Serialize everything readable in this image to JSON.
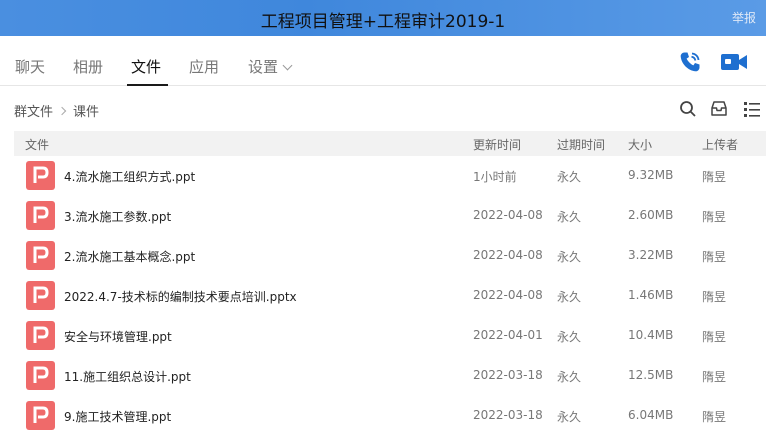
{
  "window": {
    "title": "工程项目管理+工程审计2019-1",
    "report_label": "举报"
  },
  "tabs": [
    {
      "label": "聊天",
      "active": false
    },
    {
      "label": "相册",
      "active": false
    },
    {
      "label": "文件",
      "active": true
    },
    {
      "label": "应用",
      "active": false
    },
    {
      "label": "设置",
      "active": false
    }
  ],
  "header_actions": {
    "call_icon": "phone-icon",
    "video_icon": "video-camera-icon"
  },
  "breadcrumb": {
    "root": "群文件",
    "current": "课件"
  },
  "toolbar_icons": [
    "search-icon",
    "download-box-icon",
    "list-view-icon"
  ],
  "table": {
    "columns": {
      "file": "文件",
      "updated": "更新时间",
      "expires": "过期时间",
      "size": "大小",
      "uploader": "上传者"
    },
    "rows": [
      {
        "name": "4.流水施工组织方式.ppt",
        "updated": "1小时前",
        "expires": "永久",
        "size": "9.32MB",
        "uploader": "隋昱"
      },
      {
        "name": "3.流水施工参数.ppt",
        "updated": "2022-04-08",
        "expires": "永久",
        "size": "2.60MB",
        "uploader": "隋昱"
      },
      {
        "name": "2.流水施工基本概念.ppt",
        "updated": "2022-04-08",
        "expires": "永久",
        "size": "3.22MB",
        "uploader": "隋昱"
      },
      {
        "name": "2022.4.7-技术标的编制技术要点培训.pptx",
        "updated": "2022-04-08",
        "expires": "永久",
        "size": "1.46MB",
        "uploader": "隋昱"
      },
      {
        "name": "安全与环境管理.ppt",
        "updated": "2022-04-01",
        "expires": "永久",
        "size": "10.4MB",
        "uploader": "隋昱"
      },
      {
        "name": "11.施工组织总设计.ppt",
        "updated": "2022-03-18",
        "expires": "永久",
        "size": "12.5MB",
        "uploader": "隋昱"
      },
      {
        "name": "9.施工技术管理.ppt",
        "updated": "2022-03-18",
        "expires": "永久",
        "size": "6.04MB",
        "uploader": "隋昱"
      }
    ]
  },
  "colors": {
    "titlebar": "#4a8fe0",
    "accent": "#1e6fd0",
    "file_icon": "#ef6a6a"
  }
}
